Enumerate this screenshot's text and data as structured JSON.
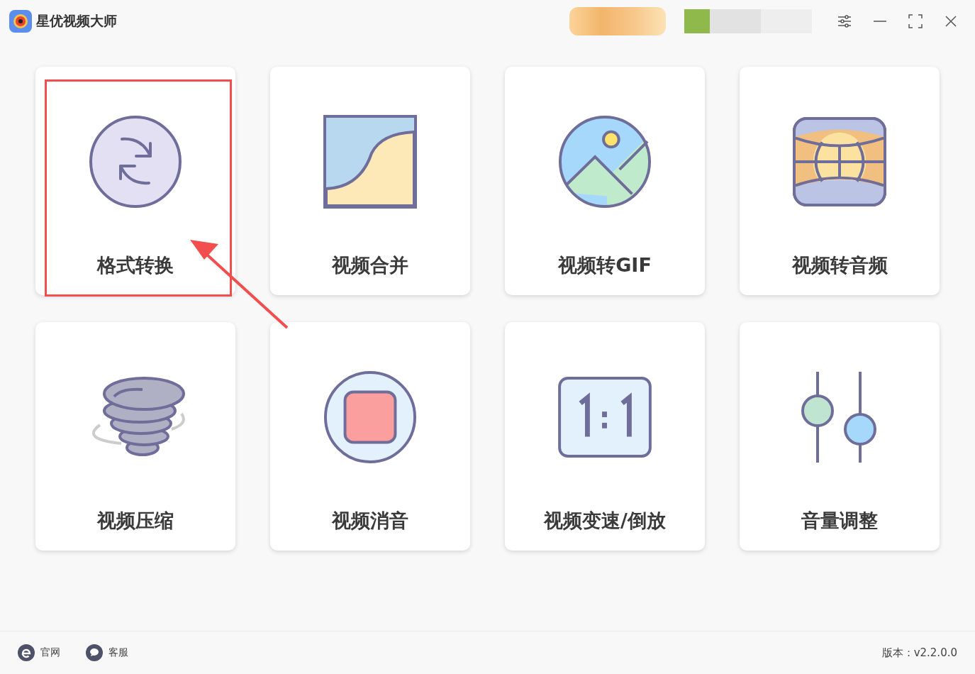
{
  "app": {
    "title": "星优视频大师"
  },
  "tools": [
    {
      "label": "格式转换",
      "kind": "convert",
      "highlighted": true
    },
    {
      "label": "视频合并",
      "kind": "merge",
      "highlighted": false
    },
    {
      "label": "视频转GIF",
      "kind": "gif",
      "highlighted": false
    },
    {
      "label": "视频转音频",
      "kind": "audio",
      "highlighted": false
    },
    {
      "label": "视频压缩",
      "kind": "compress",
      "highlighted": false
    },
    {
      "label": "视频消音",
      "kind": "mute",
      "highlighted": false
    },
    {
      "label": "视频变速/倒放",
      "kind": "speed",
      "highlighted": false
    },
    {
      "label": "音量调整",
      "kind": "volume",
      "highlighted": false
    }
  ],
  "footer": {
    "links": [
      {
        "label": "官网",
        "kind": "web"
      },
      {
        "label": "客服",
        "kind": "chat"
      }
    ],
    "version": "版本：v2.2.0.0"
  }
}
